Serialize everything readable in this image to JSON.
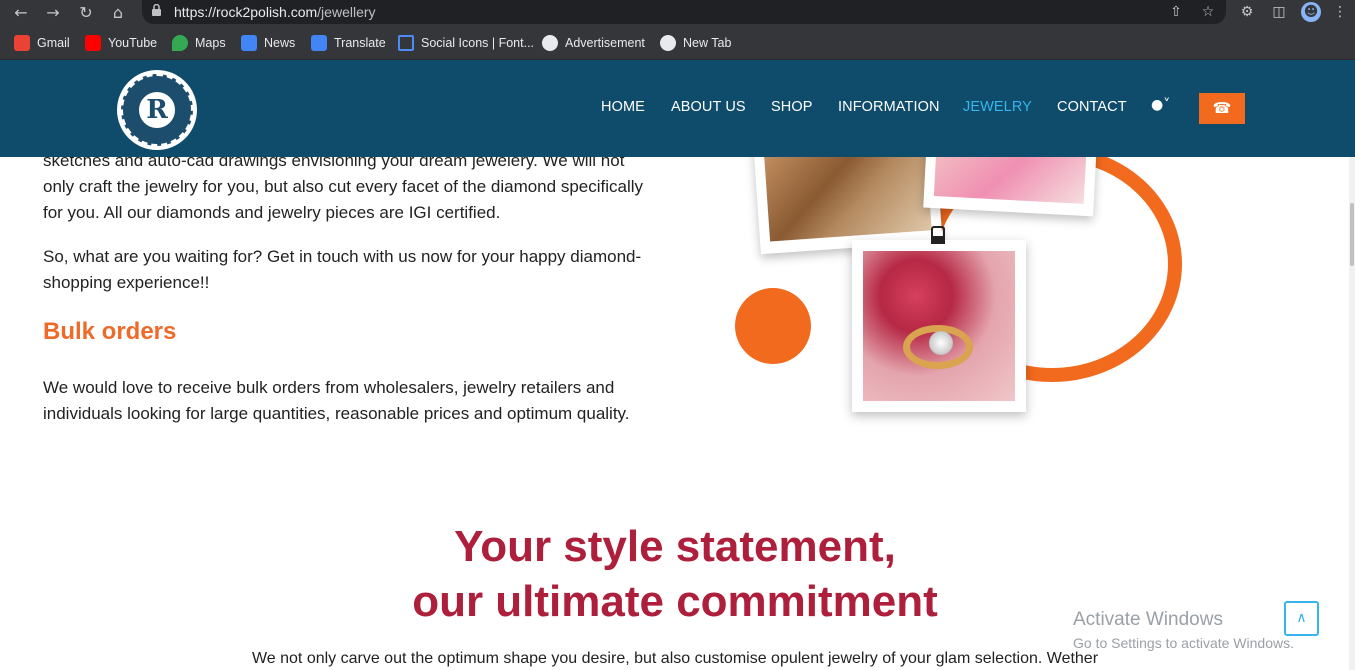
{
  "browser": {
    "url_domain": "https://rock2polish.com",
    "url_path": "/jewellery",
    "nav_icons": {
      "back": "back-arrow-icon",
      "forward": "forward-arrow-icon",
      "reload": "reload-icon",
      "home": "home-icon"
    },
    "bookmarks": [
      {
        "label": "Gmail",
        "color": "#ea4335"
      },
      {
        "label": "YouTube",
        "color": "#ff0000"
      },
      {
        "label": "Maps",
        "color": "#34a853"
      },
      {
        "label": "News",
        "color": "#4285f4"
      },
      {
        "label": "Translate",
        "color": "#4285f4"
      },
      {
        "label": "Social Icons | Font...",
        "color": "#4c8bf5"
      },
      {
        "label": "Advertisement",
        "color": "#e8eaed"
      },
      {
        "label": "New Tab",
        "color": "#e8eaed"
      }
    ]
  },
  "site": {
    "logo_letter": "R",
    "nav": [
      "HOME",
      "ABOUT US",
      "SHOP",
      "INFORMATION",
      "JEWELRY",
      "CONTACT"
    ],
    "active_nav": "JEWELRY",
    "colors": {
      "header": "#0f4c6b",
      "accent": "#f26a1e",
      "active": "#35b5ec",
      "title": "#ad1f3a"
    }
  },
  "content": {
    "para1_line1": "sketches and auto-cad drawings envisioning your dream jewelery. We will not",
    "para1_line2": "only craft the jewelry for you, but also cut every facet of the diamond specifically",
    "para1_line3": "for you. All our diamonds and jewelry pieces are IGI certified.",
    "para2_line1": "So, what are you waiting for? Get in touch with us now for your happy diamond-",
    "para2_line2": "shopping experience!!",
    "bulk_heading": "Bulk orders",
    "bulk_line1": "We would love to receive bulk orders from wholesalers, jewelry retailers and",
    "bulk_line2": "individuals looking for large quantities, reasonable prices and optimum quality.",
    "statement_line1": "Your style statement,",
    "statement_line2": "our ultimate commitment",
    "bottom_text": "We not only carve out the optimum shape you desire, but also customise opulent jewelry of your glam selection. Wether"
  },
  "overlay": {
    "activate_title": "Activate Windows",
    "activate_sub": "Go to Settings to activate Windows."
  }
}
